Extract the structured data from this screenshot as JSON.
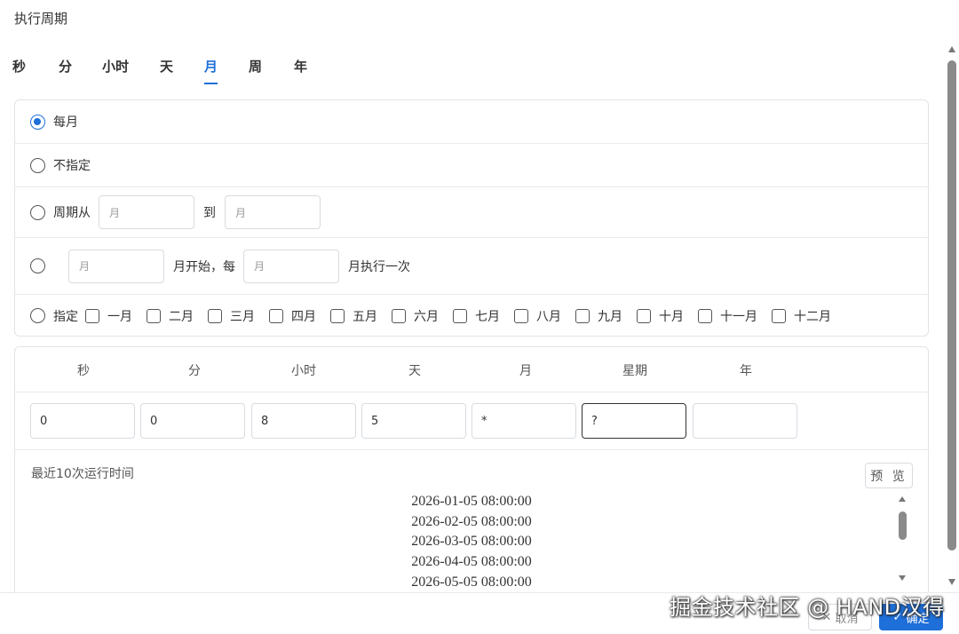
{
  "title": "执行周期",
  "tabs": [
    {
      "label": "秒",
      "active": false
    },
    {
      "label": "分",
      "active": false
    },
    {
      "label": "小时",
      "active": false
    },
    {
      "label": "天",
      "active": false
    },
    {
      "label": "月",
      "active": true
    },
    {
      "label": "周",
      "active": false
    },
    {
      "label": "年",
      "active": false
    }
  ],
  "month_options": {
    "every_month": "每月",
    "unspecified": "不指定",
    "range": {
      "label": "周期从",
      "from_placeholder": "月",
      "to_label": "到",
      "to_placeholder": "月"
    },
    "interval": {
      "start_placeholder": "月",
      "start_suffix": "月开始，每",
      "step_placeholder": "月",
      "step_suffix": "月执行一次"
    },
    "specific": {
      "label": "指定",
      "months": [
        "一月",
        "二月",
        "三月",
        "四月",
        "五月",
        "六月",
        "七月",
        "八月",
        "九月",
        "十月",
        "十一月",
        "十二月"
      ]
    },
    "selected": "every_month"
  },
  "cron": {
    "headers": [
      "秒",
      "分",
      "小时",
      "天",
      "月",
      "星期",
      "年"
    ],
    "values": [
      "0",
      "0",
      "8",
      "5",
      "*",
      "?",
      ""
    ]
  },
  "recent": {
    "label": "最近10次运行时间",
    "preview_label": "预 览",
    "times": [
      "2026-01-05 08:00:00",
      "2026-02-05 08:00:00",
      "2026-03-05 08:00:00",
      "2026-04-05 08:00:00",
      "2026-05-05 08:00:00"
    ]
  },
  "footer": {
    "cancel_label": "取消",
    "ok_label": "确定"
  },
  "watermark": "掘金技术社区 @ HAND汉得",
  "colors": {
    "accent": "#1e6fd9"
  }
}
